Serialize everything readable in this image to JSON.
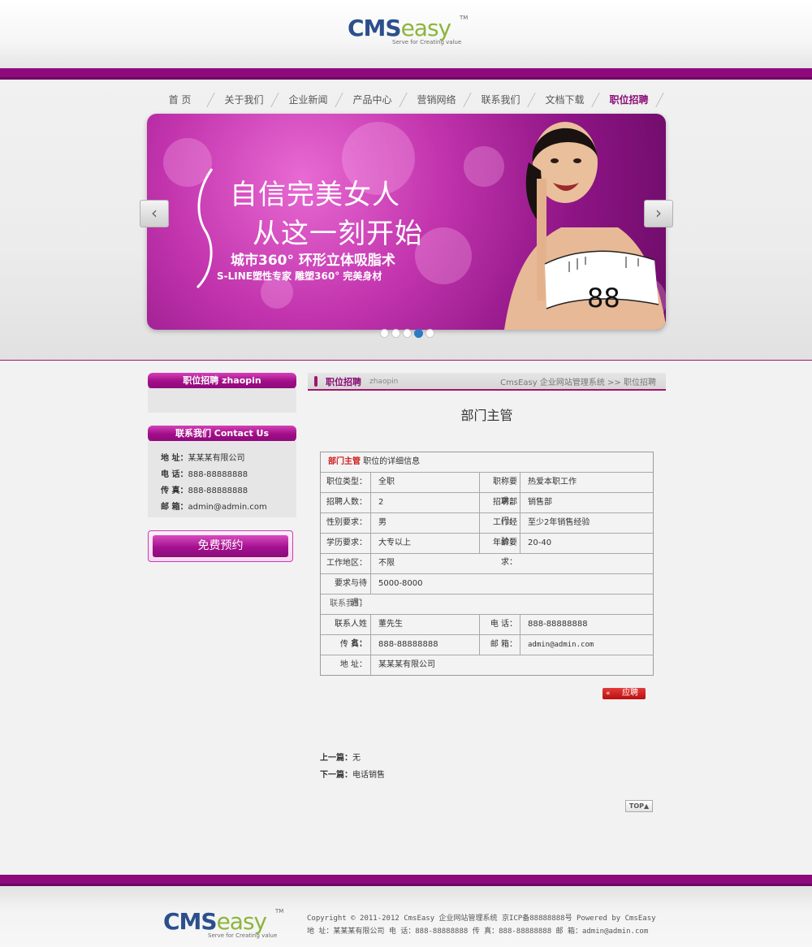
{
  "brand": {
    "logo_main": "CMS",
    "logo_easy": "easy",
    "logo_tm": "TM",
    "logo_slogan": "Serve for Creating value"
  },
  "nav": {
    "items": [
      {
        "label": "首 页"
      },
      {
        "label": "关于我们"
      },
      {
        "label": "企业新闻"
      },
      {
        "label": "产品中心"
      },
      {
        "label": "营销网络"
      },
      {
        "label": "联系我们"
      },
      {
        "label": "文档下载"
      },
      {
        "label": "职位招聘",
        "active": true
      }
    ]
  },
  "banner": {
    "line1": "自信完美女人",
    "line2": "从这一刻开始",
    "line3": "城市360° 环形立体吸脂术",
    "line4": "S-LINE塑性专家 雕塑360° 完美身材",
    "tape_number": "88",
    "prev_arrow": "‹",
    "next_arrow": "›",
    "dot_count": 5,
    "active_dot": 3
  },
  "sidebar": {
    "zhaopin_title": "职位招聘 zhaopin",
    "contact_title": "联系我们 Contact Us",
    "contact": [
      {
        "label": "地 址：",
        "value": "某某某有限公司"
      },
      {
        "label": "电 话：",
        "value": "888-88888888"
      },
      {
        "label": "传 真：",
        "value": "888-88888888"
      },
      {
        "label": "邮 箱：",
        "value": "admin@admin.com"
      }
    ],
    "reserve_label": "免费预约"
  },
  "breadcrumb": {
    "title": "职位招聘",
    "subtitle": "zhaopin",
    "path_home": "CmsEasy 企业网站管理系统",
    "path_sep": ">>",
    "path_current": "职位招聘"
  },
  "job": {
    "title": "部门主管",
    "header_name": "部门主管",
    "header_suffix": "职位的详细信息",
    "fields": {
      "type_label": "职位类型：",
      "type_value": "全职",
      "title_req_label": "职称要求：",
      "title_req_value": "热爱本职工作",
      "count_label": "招聘人数：",
      "count_value": "2",
      "dept_label": "招聘部门：",
      "dept_value": "销售部",
      "gender_label": "性别要求：",
      "gender_value": "男",
      "exp_label": "工作经验：",
      "exp_value": "至少2年销售经验",
      "edu_label": "学历要求：",
      "edu_value": "大专以上",
      "age_label": "年龄要求：",
      "age_value": "20-40",
      "area_label": "工作地区：",
      "area_value": "不限",
      "salary_label": "要求与待遇：",
      "salary_value": "5000-8000"
    },
    "contact_header": "联系我们",
    "contact": {
      "name_label": "联系人姓名：",
      "name_value": "董先生",
      "phone_label": "电 话：",
      "phone_value": "888-88888888",
      "fax_label": "传 真：",
      "fax_value": "888-88888888",
      "email_label": "邮 箱：",
      "email_value": "admin@admin.com",
      "addr_label": "地 址：",
      "addr_value": "某某某有限公司"
    },
    "apply_arrow": "«",
    "apply_label": "应聘"
  },
  "pager": {
    "prev_label": "上一篇：",
    "prev_value": "无",
    "next_label": "下一篇：",
    "next_value": "电话销售"
  },
  "top_button": "TOP▲",
  "footer": {
    "copyright": "Copyright © 2011-2012  CmsEasy 企业网站管理系统  京ICP备88888888号  Powered by CmsEasy",
    "contact_line": "地 址：某某某有限公司  电 话：888-88888888  传 真：888-88888888  邮 箱：admin@admin.com"
  },
  "colors": {
    "brand_purple": "#8e0a7c",
    "accent_red": "#d01c1c",
    "logo_blue": "#2c4f8c",
    "logo_green": "#8cb53a"
  }
}
